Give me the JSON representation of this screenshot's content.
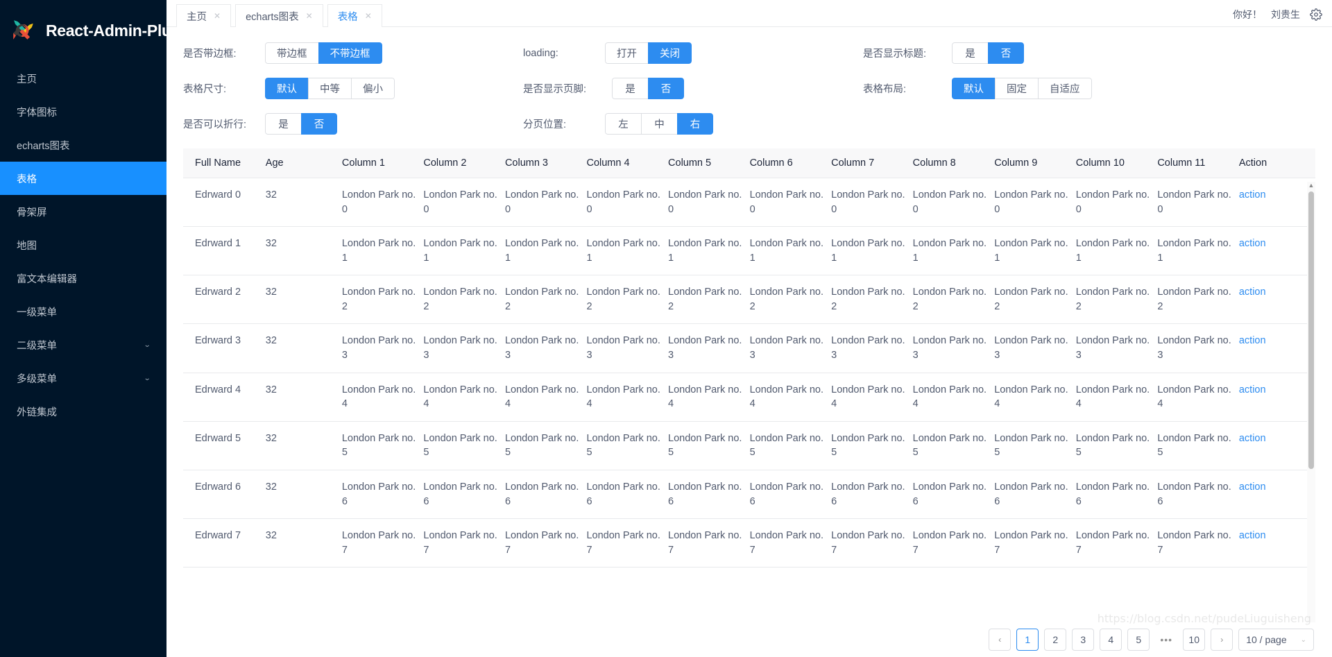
{
  "brand": {
    "name": "React-Admin-Plus",
    "logo_icon": "pinwheel-arrows-logo"
  },
  "sidebar": {
    "items": [
      {
        "label": "主页",
        "active": false,
        "expandable": false
      },
      {
        "label": "字体图标",
        "active": false,
        "expandable": false
      },
      {
        "label": "echarts图表",
        "active": false,
        "expandable": false
      },
      {
        "label": "表格",
        "active": true,
        "expandable": false
      },
      {
        "label": "骨架屏",
        "active": false,
        "expandable": false
      },
      {
        "label": "地图",
        "active": false,
        "expandable": false
      },
      {
        "label": "富文本编辑器",
        "active": false,
        "expandable": false
      },
      {
        "label": "一级菜单",
        "active": false,
        "expandable": false
      },
      {
        "label": "二级菜单",
        "active": false,
        "expandable": true
      },
      {
        "label": "多级菜单",
        "active": false,
        "expandable": true
      },
      {
        "label": "外链集成",
        "active": false,
        "expandable": false
      }
    ],
    "chevron_icon": "chevron-down-icon"
  },
  "tabs": [
    {
      "label": "主页",
      "active": false,
      "close_icon": "close-icon"
    },
    {
      "label": "echarts图表",
      "active": false,
      "close_icon": "close-icon"
    },
    {
      "label": "表格",
      "active": true,
      "close_icon": "close-icon"
    }
  ],
  "header": {
    "greeting": "你好！",
    "username": "刘贵生",
    "settings_icon": "gear-icon"
  },
  "controls": [
    {
      "label": "是否带边框:",
      "options": [
        "带边框",
        "不带边框"
      ],
      "selected": 1
    },
    {
      "label": "loading:",
      "options": [
        "打开",
        "关闭"
      ],
      "selected": 1
    },
    {
      "label": "是否显示标题:",
      "options": [
        "是",
        "否"
      ],
      "selected": 1
    },
    {
      "label": "表格尺寸:",
      "options": [
        "默认",
        "中等",
        "偏小"
      ],
      "selected": 0
    },
    {
      "label": "是否显示页脚:",
      "options": [
        "是",
        "否"
      ],
      "selected": 1
    },
    {
      "label": "表格布局:",
      "options": [
        "默认",
        "固定",
        "自适应"
      ],
      "selected": 0
    },
    {
      "label": "是否可以折行:",
      "options": [
        "是",
        "否"
      ],
      "selected": 1
    },
    {
      "label": "分页位置:",
      "options": [
        "左",
        "中",
        "右"
      ],
      "selected": 2
    }
  ],
  "table": {
    "headers": [
      "Full Name",
      "Age",
      "Column 1",
      "Column 2",
      "Column 3",
      "Column 4",
      "Column 5",
      "Column 6",
      "Column 7",
      "Column 8",
      "Column 9",
      "Column 10",
      "Column 11",
      "Action"
    ],
    "rows": [
      {
        "name": "Edrward 0",
        "age": "32",
        "cell": "London Park no. 0",
        "action": "action"
      },
      {
        "name": "Edrward 1",
        "age": "32",
        "cell": "London Park no. 1",
        "action": "action"
      },
      {
        "name": "Edrward 2",
        "age": "32",
        "cell": "London Park no. 2",
        "action": "action"
      },
      {
        "name": "Edrward 3",
        "age": "32",
        "cell": "London Park no. 3",
        "action": "action"
      },
      {
        "name": "Edrward 4",
        "age": "32",
        "cell": "London Park no. 4",
        "action": "action"
      },
      {
        "name": "Edrward 5",
        "age": "32",
        "cell": "London Park no. 5",
        "action": "action"
      },
      {
        "name": "Edrward 6",
        "age": "32",
        "cell": "London Park no. 6",
        "action": "action"
      },
      {
        "name": "Edrward 7",
        "age": "32",
        "cell": "London Park no. 7",
        "action": "action"
      }
    ]
  },
  "pagination": {
    "prev": "‹",
    "pages": [
      "1",
      "2",
      "3",
      "4",
      "5"
    ],
    "ellipsis": "•••",
    "last": "10",
    "next": "›",
    "current": "1",
    "page_size": "10 / page",
    "caret_icon": "chevron-down-icon"
  },
  "watermark": "https://blog.csdn.net/pudeLiuguisheng",
  "colors": {
    "primary": "#2d8cf0",
    "sidebar_bg": "#001529",
    "sidebar_active": "#1890ff",
    "text": "#515a6e",
    "border": "#e8eaec"
  }
}
